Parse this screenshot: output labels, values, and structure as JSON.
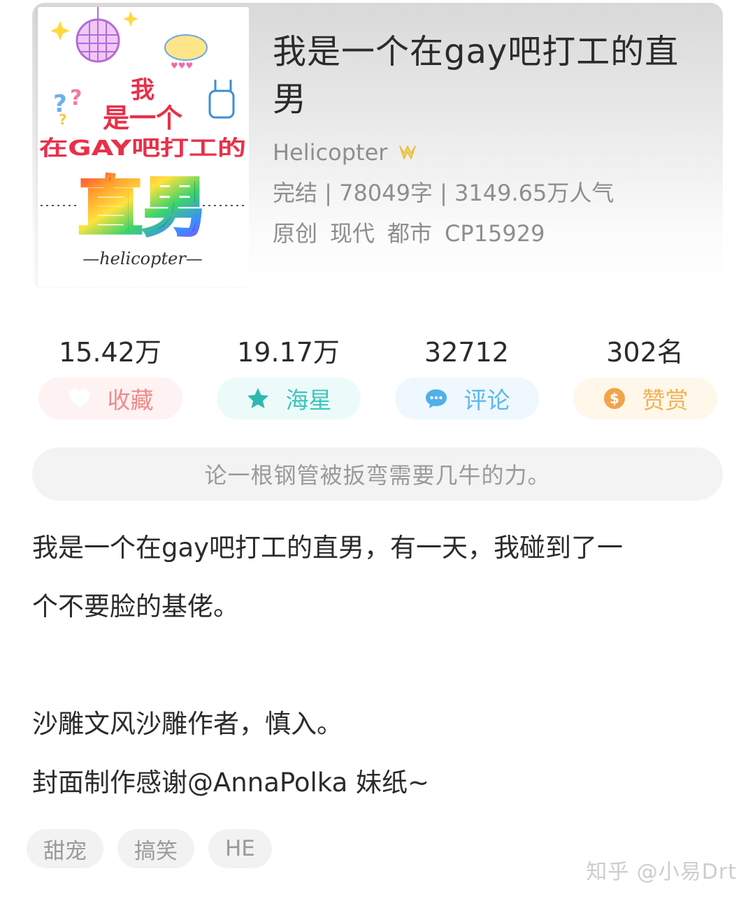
{
  "book": {
    "title": "我是一个在gay吧打工的直男",
    "author": "Helicopter",
    "author_badge_icon": "vip-crown-icon",
    "meta": "完结 | 78049字 | 3149.65万人气",
    "genre_tags": [
      "原创",
      "现代",
      "都市",
      "CP15929"
    ]
  },
  "cover": {
    "line1": "我",
    "line2": "是一个",
    "line3": "在GAY吧打工的",
    "line4": "直男",
    "signature": "—helicopter—"
  },
  "stats": [
    {
      "value": "15.42万",
      "label": "收藏",
      "icon": "heart-icon",
      "color": "#f08a8a"
    },
    {
      "value": "19.17万",
      "label": "海星",
      "icon": "star-icon",
      "color": "#3cc4bd"
    },
    {
      "value": "32712",
      "label": "评论",
      "icon": "comment-icon",
      "color": "#5ab8ec"
    },
    {
      "value": "302名",
      "label": "赞赏",
      "icon": "coin-icon",
      "color": "#f0b25a"
    }
  ],
  "quote": "论一根钢管被扳弯需要几牛的力。",
  "description": [
    "我是一个在gay吧打工的直男，有一天，我碰到了一",
    "个不要脸的基佬。",
    "",
    "沙雕文风沙雕作者，慎入。",
    "封面制作感谢@AnnaPolka 妹纸~"
  ],
  "chips": [
    "甜宠",
    "搞笑",
    "HE"
  ],
  "watermark": "知乎 @小易Drt"
}
